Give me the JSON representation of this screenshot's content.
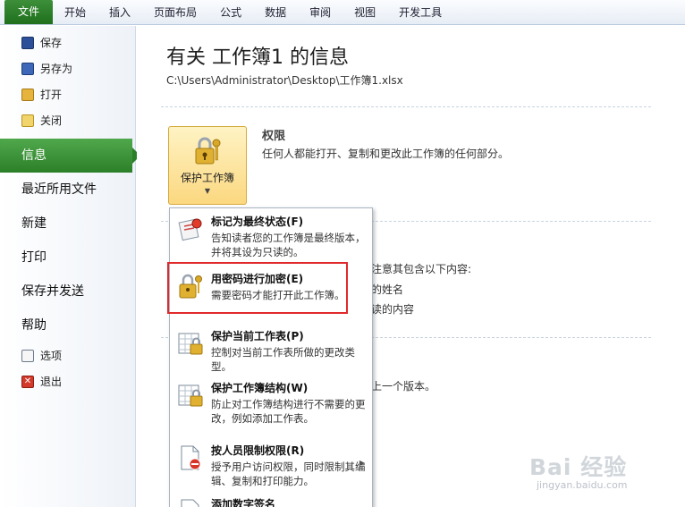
{
  "tabs": [
    "文件",
    "开始",
    "插入",
    "页面布局",
    "公式",
    "数据",
    "审阅",
    "视图",
    "开发工具"
  ],
  "left": {
    "cmd_save": "保存",
    "cmd_saveas": "另存为",
    "cmd_open": "打开",
    "cmd_close": "关闭",
    "nav_info": "信息",
    "nav_recent": "最近所用文件",
    "nav_new": "新建",
    "nav_print": "打印",
    "nav_share": "保存并发送",
    "nav_help": "帮助",
    "cmd_options": "选项",
    "cmd_exit": "退出"
  },
  "main": {
    "title": "有关 工作簿1 的信息",
    "path": "C:\\Users\\Administrator\\Desktop\\工作簿1.xlsx",
    "protect_button": "保护工作簿",
    "perm_title": "权限",
    "perm_desc": "任何人都能打开、复制和更改此工作簿的任何部分。",
    "bg_line1": "注意其包含以下内容:",
    "bg_line2": "的姓名",
    "bg_line3": "读的内容",
    "bg_line4": "上一个版本。"
  },
  "menu": [
    {
      "title": "标记为最终状态(F)",
      "desc": "告知读者您的工作簿是最终版本，并将其设为只读的。"
    },
    {
      "title": "用密码进行加密(E)",
      "desc": "需要密码才能打开此工作簿。"
    },
    {
      "title": "保护当前工作表(P)",
      "desc": "控制对当前工作表所做的更改类型。"
    },
    {
      "title": "保护工作簿结构(W)",
      "desc": "防止对工作簿结构进行不需要的更改，例如添加工作表。"
    },
    {
      "title": "按人员限制权限(R)",
      "desc": "授予用户访问权限，同时限制其编辑、复制和打印能力。"
    },
    {
      "title": "添加数字签名"
    }
  ],
  "watermark": {
    "brand": "Bai 经验",
    "url": "jingyan.baidu.com"
  }
}
